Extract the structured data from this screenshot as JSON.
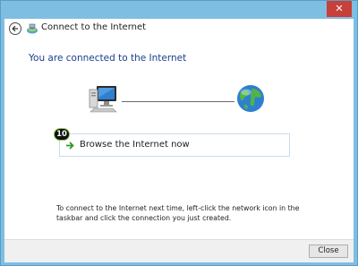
{
  "window": {
    "close_glyph": "✕",
    "close_color": "#c7403a",
    "frame_color": "#7fbee3"
  },
  "header": {
    "back_icon": "back-arrow-icon",
    "wizard_icon": "network-wizard-icon",
    "title": "Connect to the Internet"
  },
  "main": {
    "heading": "You are connected to the Internet",
    "heading_color": "#1a3e8c",
    "diagram": {
      "left_icon": "computer-icon",
      "right_icon": "globe-icon"
    },
    "step_badge": "10",
    "browse_link": {
      "icon": "green-arrow-icon",
      "label": "Browse the Internet now"
    },
    "info_text": "To connect to the Internet next time, left-click the network icon in the taskbar and click the connection you just created."
  },
  "footer": {
    "close_label": "Close"
  }
}
